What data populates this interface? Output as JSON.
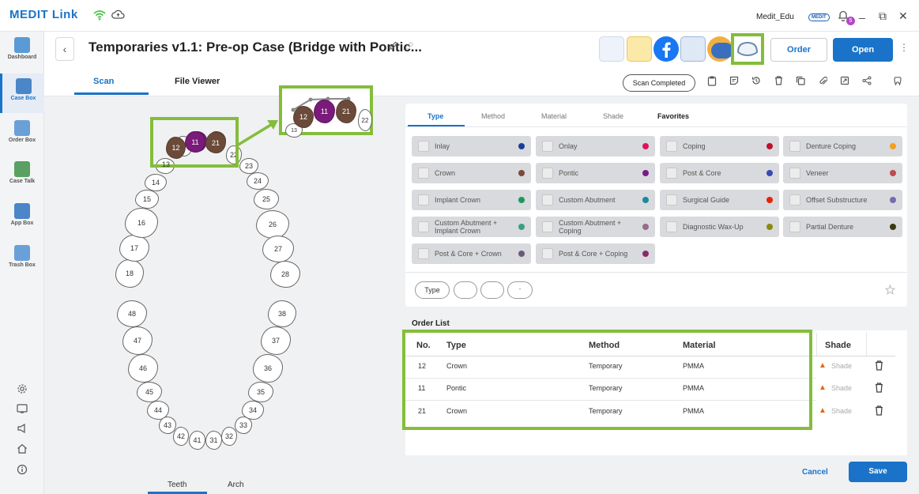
{
  "app": {
    "logo": "MEDIT Link",
    "user": "Medit_Edu",
    "badge": "MEDIT",
    "notif_count": "5"
  },
  "window": {
    "minimize": "_",
    "restore": "⧉",
    "close": "✕"
  },
  "sidebar": {
    "items": [
      {
        "label": "Dashboard",
        "color": "#5b9bd5"
      },
      {
        "label": "Case Box",
        "color": "#4a86c8"
      },
      {
        "label": "Order Box",
        "color": "#6aa0d8"
      },
      {
        "label": "Case Talk",
        "color": "#5aa060"
      },
      {
        "label": "App Box",
        "color": "#4a86c8"
      },
      {
        "label": "Trash Box",
        "color": "#6aa0d8"
      }
    ]
  },
  "header": {
    "back": "‹",
    "title": "Temporaries v1.1: Pre-op Case (Bridge with Pontic...",
    "order": "Order",
    "open": "Open",
    "kebab": "⋮"
  },
  "tabs": {
    "scan": "Scan",
    "file_viewer": "File Viewer",
    "status": "Scan Completed"
  },
  "teeth_view": {
    "bottom_tabs": {
      "teeth": "Teeth",
      "arch": "Arch"
    },
    "upper": [
      "11",
      "21",
      "22",
      "23",
      "24",
      "25",
      "26",
      "27",
      "28",
      "18",
      "17",
      "16",
      "15",
      "14",
      "13",
      "12"
    ],
    "lower": [
      "48",
      "47",
      "46",
      "45",
      "44",
      "43",
      "42",
      "41",
      "31",
      "32",
      "33",
      "34",
      "35",
      "36",
      "37",
      "38"
    ],
    "zoom_labels": [
      "12",
      "11",
      "21",
      "22",
      "13"
    ]
  },
  "type_panel": {
    "tabs": [
      "Type",
      "Method",
      "Material",
      "Shade",
      "Favorites"
    ],
    "chips": [
      {
        "label": "Inlay",
        "color": "#1a3d99"
      },
      {
        "label": "Onlay",
        "color": "#e0115f"
      },
      {
        "label": "Coping",
        "color": "#c0102a"
      },
      {
        "label": "Denture Coping",
        "color": "#f4a020"
      },
      {
        "label": "Crown",
        "color": "#7a4a3a"
      },
      {
        "label": "Pontic",
        "color": "#7a1a8a"
      },
      {
        "label": "Post & Core",
        "color": "#3a4ab0"
      },
      {
        "label": "Veneer",
        "color": "#c04a50"
      },
      {
        "label": "Implant Crown",
        "color": "#1a9a5a"
      },
      {
        "label": "Custom Abutment",
        "color": "#1a8aa0"
      },
      {
        "label": "Surgical Guide",
        "color": "#e8220a"
      },
      {
        "label": "Offset Substructure",
        "color": "#7a6ab0"
      },
      {
        "label": "Custom Abutment + Implant Crown",
        "color": "#3aa080"
      },
      {
        "label": "Custom Abutment + Coping",
        "color": "#9a6a8a"
      },
      {
        "label": "Diagnostic Wax-Up",
        "color": "#8a8a10"
      },
      {
        "label": "Partial Denture",
        "color": "#3a3a10"
      },
      {
        "label": "Post & Core + Crown",
        "color": "#6a5a7a"
      },
      {
        "label": "Post & Core + Coping",
        "color": "#8a2a6a"
      }
    ],
    "filters": [
      "Type",
      "",
      "",
      "-"
    ]
  },
  "order_list": {
    "title": "Order List",
    "headers": [
      "No.",
      "Type",
      "Method",
      "Material",
      "Shade"
    ],
    "rows": [
      {
        "no": "12",
        "type": "Crown",
        "method": "Temporary",
        "material": "PMMA",
        "shade": "Shade"
      },
      {
        "no": "11",
        "type": "Pontic",
        "method": "Temporary",
        "material": "PMMA",
        "shade": "Shade"
      },
      {
        "no": "21",
        "type": "Crown",
        "method": "Temporary",
        "material": "PMMA",
        "shade": "Shade"
      }
    ]
  },
  "footer": {
    "cancel": "Cancel",
    "save": "Save"
  }
}
